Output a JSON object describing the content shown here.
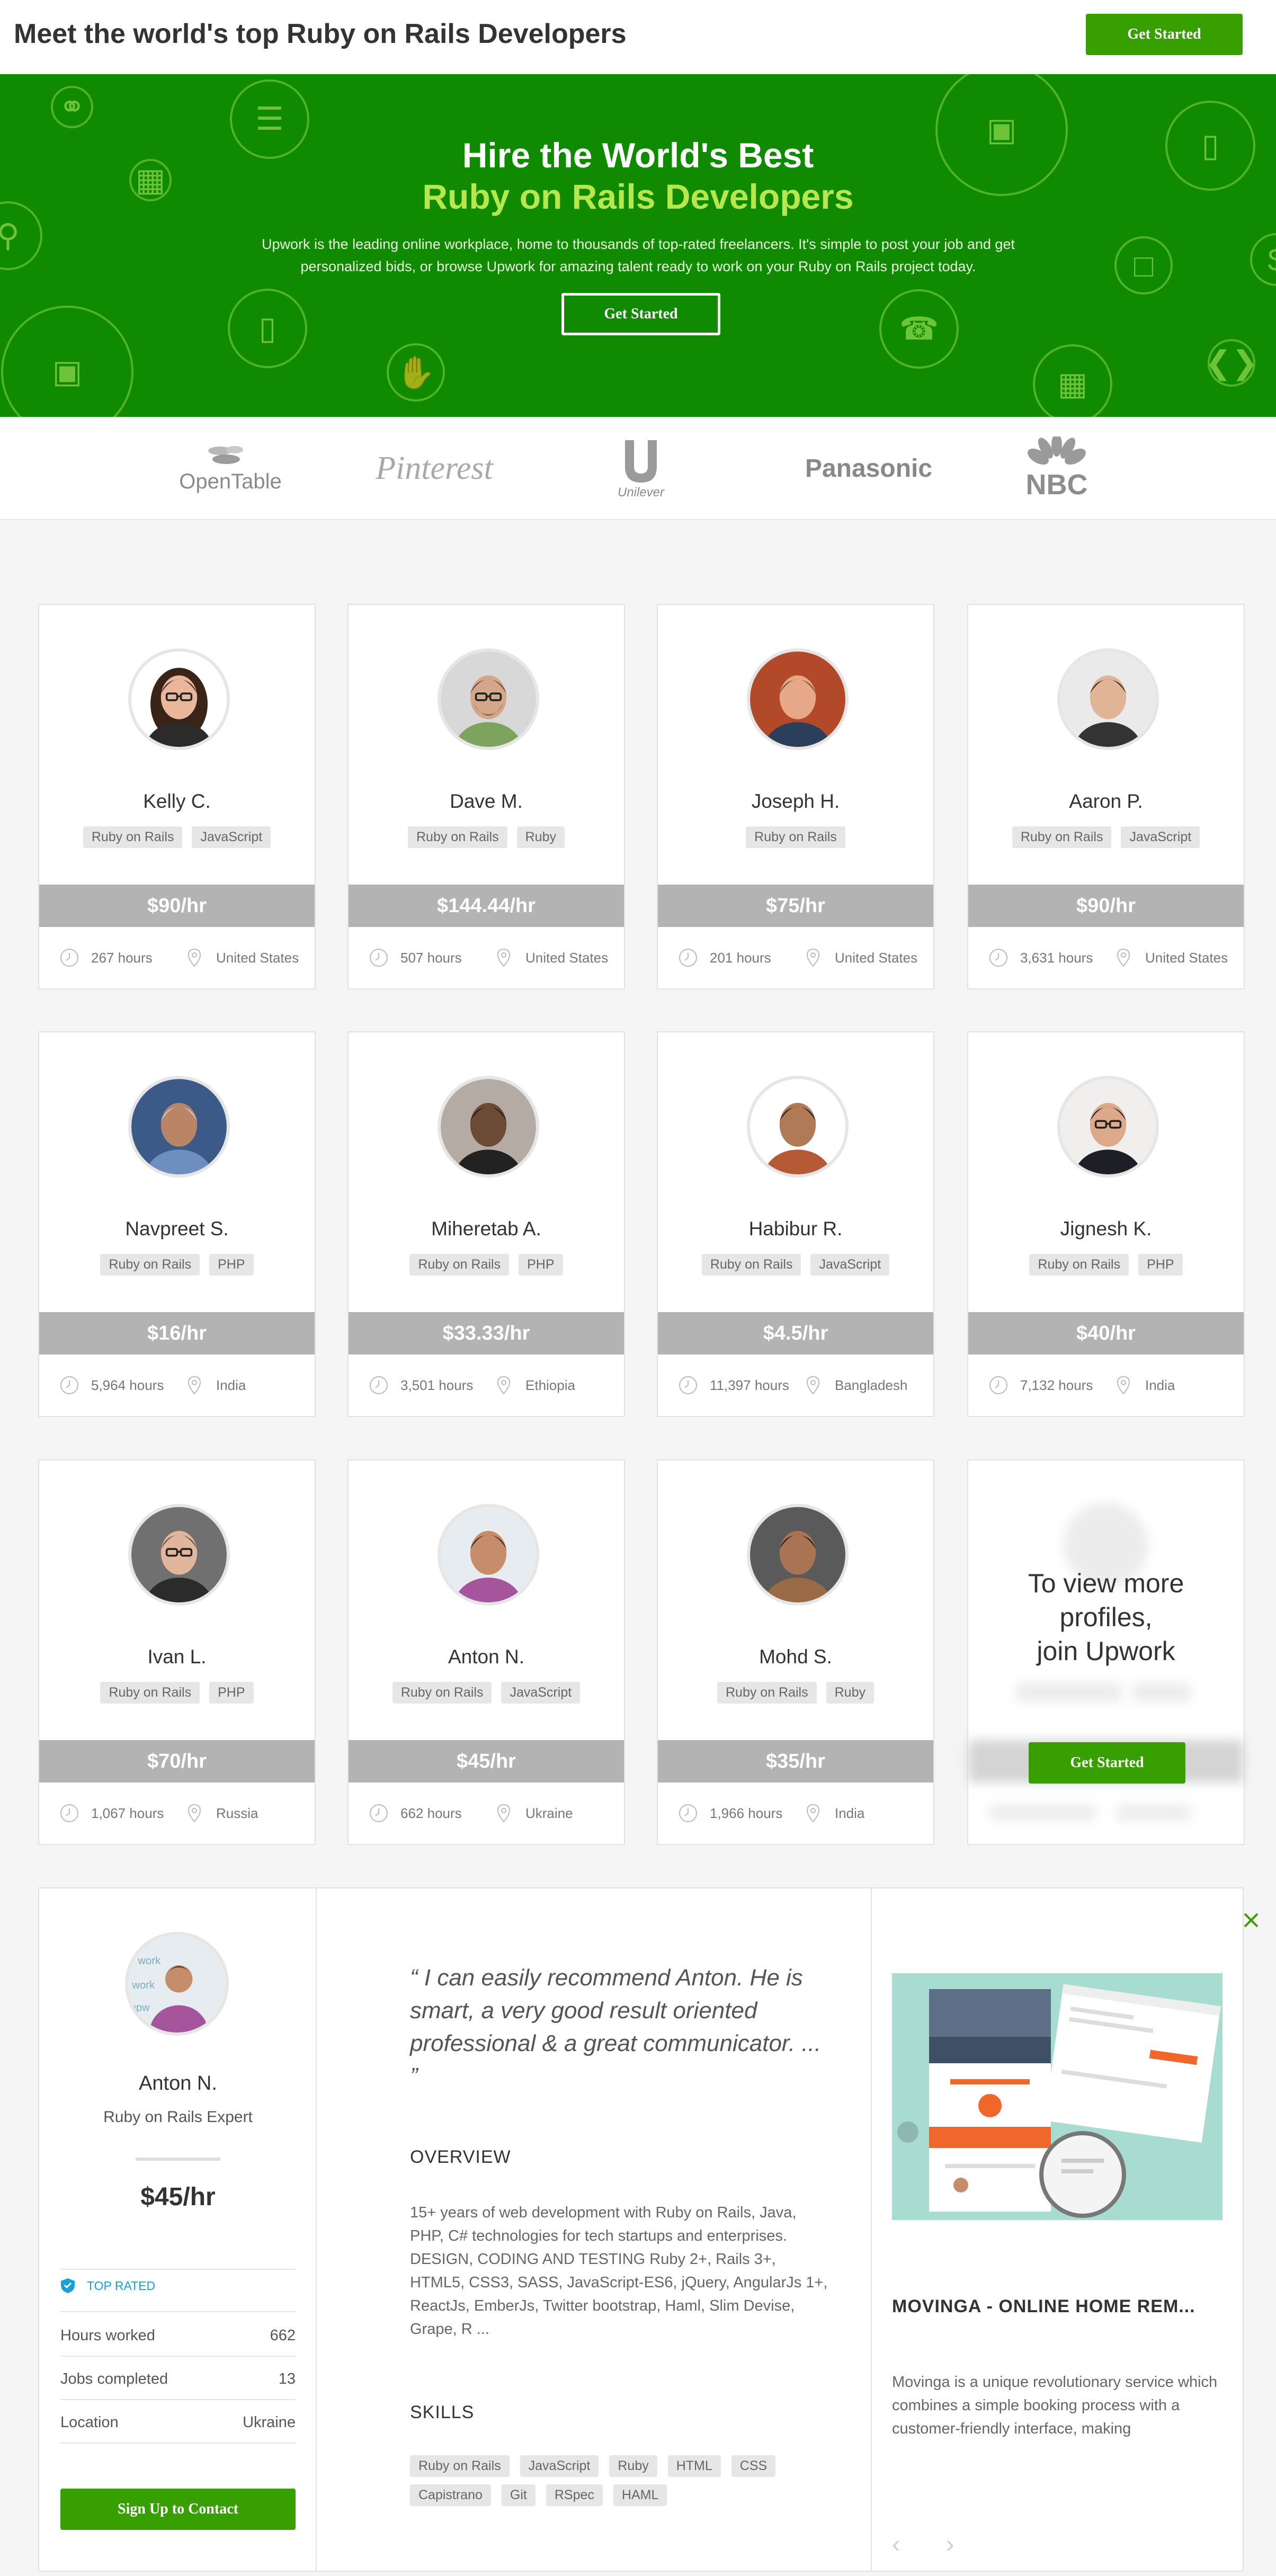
{
  "header": {
    "title": "Meet the world's top Ruby on Rails Developers",
    "cta": "Get Started"
  },
  "hero": {
    "title_line1": "Hire the World's Best",
    "title_line2": "Ruby on Rails Developers",
    "description": "Upwork is the leading online workplace, home to thousands of top-rated freelancers. It's simple to post your job and get personalized bids, or browse Upwork for amazing talent ready to work on your Ruby on Rails project today.",
    "cta": "Get Started"
  },
  "logos": {
    "opentable": "OpenTable",
    "pinterest": "Pinterest",
    "unilever": "Unilever",
    "panasonic": "Panasonic",
    "nbc": "NBC"
  },
  "profiles": [
    {
      "name": "Kelly C.",
      "tags": [
        "Ruby on Rails",
        "JavaScript"
      ],
      "rate": "$90/hr",
      "hours": "267 hours",
      "location": "United States"
    },
    {
      "name": "Dave M.",
      "tags": [
        "Ruby on Rails",
        "Ruby"
      ],
      "rate": "$144.44/hr",
      "hours": "507 hours",
      "location": "United States"
    },
    {
      "name": "Joseph H.",
      "tags": [
        "Ruby on Rails"
      ],
      "rate": "$75/hr",
      "hours": "201 hours",
      "location": "United States"
    },
    {
      "name": "Aaron P.",
      "tags": [
        "Ruby on Rails",
        "JavaScript"
      ],
      "rate": "$90/hr",
      "hours": "3,631 hours",
      "location": "United States"
    },
    {
      "name": "Navpreet S.",
      "tags": [
        "Ruby on Rails",
        "PHP"
      ],
      "rate": "$16/hr",
      "hours": "5,964 hours",
      "location": "India"
    },
    {
      "name": "Miheretab A.",
      "tags": [
        "Ruby on Rails",
        "PHP"
      ],
      "rate": "$33.33/hr",
      "hours": "3,501 hours",
      "location": "Ethiopia"
    },
    {
      "name": "Habibur R.",
      "tags": [
        "Ruby on Rails",
        "JavaScript"
      ],
      "rate": "$4.5/hr",
      "hours": "11,397 hours",
      "location": "Bangladesh"
    },
    {
      "name": "Jignesh K.",
      "tags": [
        "Ruby on Rails",
        "PHP"
      ],
      "rate": "$40/hr",
      "hours": "7,132 hours",
      "location": "India"
    },
    {
      "name": "Ivan L.",
      "tags": [
        "Ruby on Rails",
        "PHP"
      ],
      "rate": "$70/hr",
      "hours": "1,067 hours",
      "location": "Russia"
    },
    {
      "name": "Anton N.",
      "tags": [
        "Ruby on Rails",
        "JavaScript"
      ],
      "rate": "$45/hr",
      "hours": "662 hours",
      "location": "Ukraine"
    },
    {
      "name": "Mohd S.",
      "tags": [
        "Ruby on Rails",
        "Ruby"
      ],
      "rate": "$35/hr",
      "hours": "1,966 hours",
      "location": "India"
    }
  ],
  "join_card": {
    "message_line1": "To view more",
    "message_line2": "profiles,",
    "message_line3": "join Upwork",
    "cta": "Get Started"
  },
  "detail": {
    "name": "Anton N.",
    "title": "Ruby on Rails Expert",
    "rate": "$45/hr",
    "badge": "TOP RATED",
    "hours_label": "Hours worked",
    "hours_value": "662",
    "jobs_label": "Jobs completed",
    "jobs_value": "13",
    "location_label": "Location",
    "location_value": "Ukraine",
    "cta": "Sign Up to Contact",
    "quote": "“ I can easily recommend Anton. He is smart, a very good result oriented professional & a great communicator. ... ”",
    "overview_heading": "OVERVIEW",
    "overview": "15+ years of web development with Ruby on Rails, Java, PHP, C# technologies for tech startups and enterprises. DESIGN, CODING AND TESTING Ruby 2+, Rails 3+, HTML5, CSS3, SASS, JavaScript-ES6, jQuery, AngularJs 1+, ReactJs, EmberJs, Twitter bootstrap, Haml, Slim Devise, Grape, R ...",
    "skills_heading": "SKILLS",
    "skills": [
      "Ruby on Rails",
      "JavaScript",
      "Ruby",
      "HTML",
      "CSS",
      "Capistrano",
      "Git",
      "RSpec",
      "HAML"
    ],
    "project_title": "MOVINGA - ONLINE HOME REM...",
    "project_desc": "Movinga is a unique revolutionary service which combines a simple booking process with a customer-friendly interface, making",
    "prev_arrow": "‹",
    "next_arrow": "›"
  },
  "colors": {
    "brand_green": "#37a000",
    "hero_green": "#108a00",
    "accent_lime": "#b6e84e",
    "rate_gray": "#b3b3b3",
    "top_rated_blue": "#1a9fd6"
  }
}
